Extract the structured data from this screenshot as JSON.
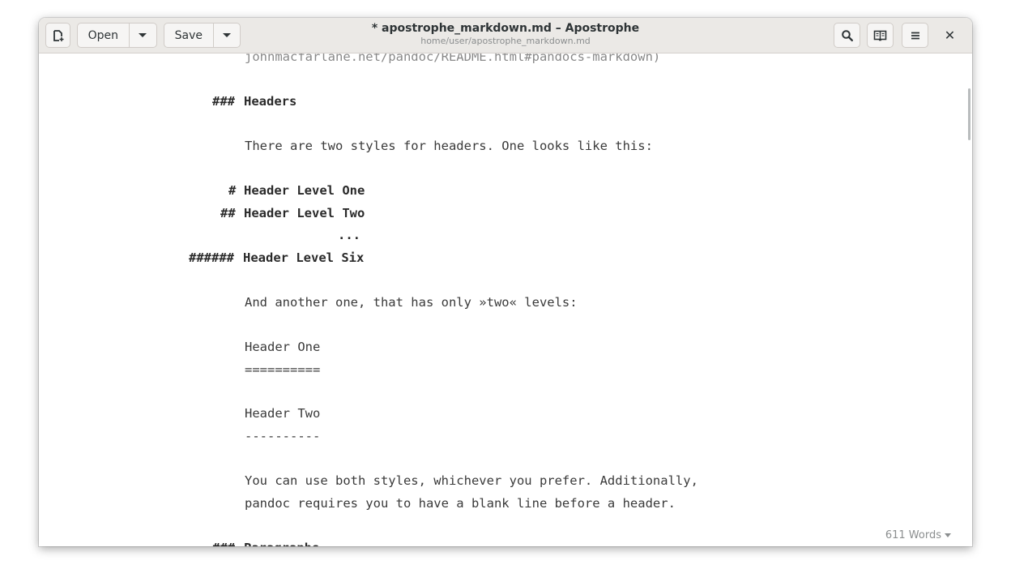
{
  "window": {
    "title": "* apostrophe_markdown.md – Apostrophe",
    "subtitle": "home/user/apostrophe_markdown.md"
  },
  "toolbar": {
    "new_icon": "new-document-icon",
    "open_label": "Open",
    "save_label": "Save",
    "search_icon": "search-icon",
    "preview_icon": "book-preview-icon",
    "menu_icon": "hamburger-menu-icon",
    "close_icon": "close-icon",
    "close_glyph": "✕"
  },
  "editor": {
    "lines": [
      {
        "text": "johnmacfarlane.net/pandoc/README.html#pandocs-markdown)",
        "kind": "cut-top"
      },
      {
        "hashes": "###",
        "text": "Headers",
        "kind": "heading"
      },
      {
        "text": "There are two styles for headers. One looks like this:",
        "kind": "body"
      },
      {
        "hashes": "#",
        "text": "Header Level One",
        "kind": "heading"
      },
      {
        "hashes": "##",
        "text": "Header Level Two",
        "kind": "heading"
      },
      {
        "text": "...",
        "kind": "ellipsis"
      },
      {
        "hashes": "######",
        "text": "Header Level Six",
        "kind": "heading"
      },
      {
        "text": "And another one, that has only »two« levels:",
        "kind": "body"
      },
      {
        "text": "Header One",
        "kind": "body"
      },
      {
        "text": "==========",
        "kind": "body"
      },
      {
        "text": "Header Two",
        "kind": "body"
      },
      {
        "text": "----------",
        "kind": "body"
      },
      {
        "text": "You can use both styles, whichever you prefer. Additionally,",
        "kind": "body"
      },
      {
        "text": "pandoc requires you to have a blank line before a header.",
        "kind": "body"
      },
      {
        "hashes": "###",
        "text": "Paragraphs",
        "kind": "heading-cut"
      }
    ]
  },
  "status": {
    "word_count": "611 Words"
  }
}
